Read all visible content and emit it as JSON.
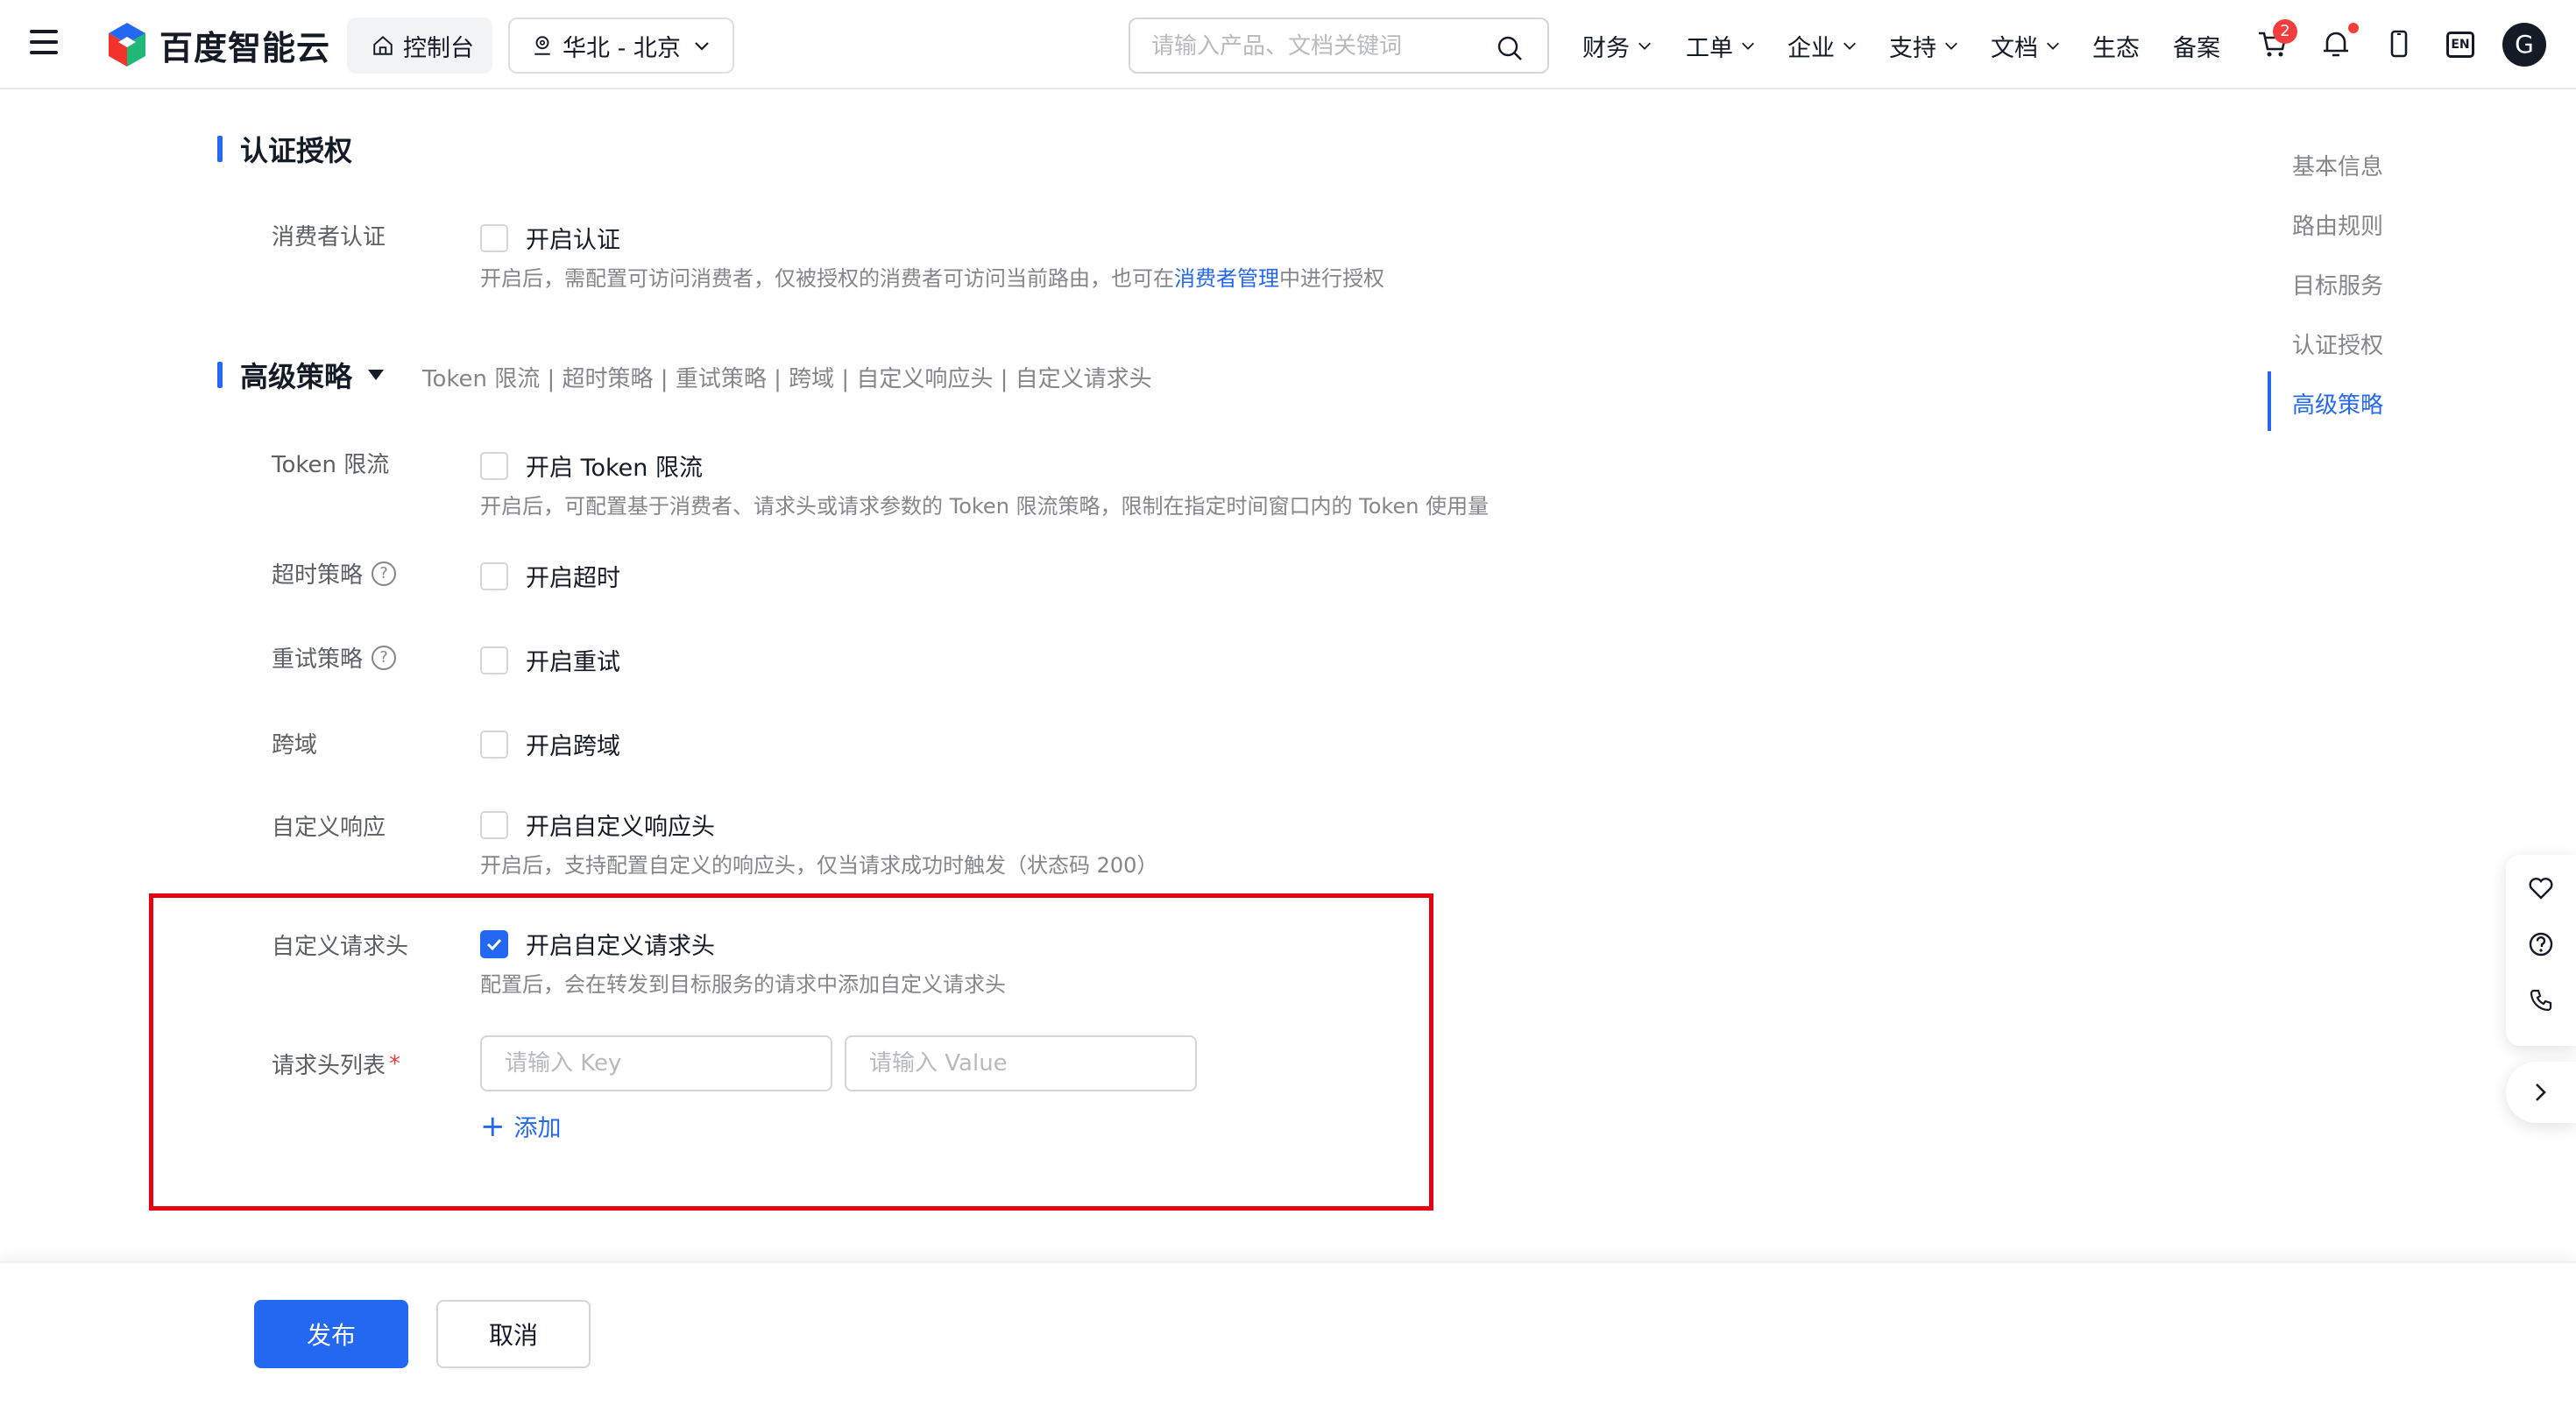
{
  "header": {
    "brand": "百度智能云",
    "console_label": "控制台",
    "region_label": "华北 - 北京",
    "search_placeholder": "请输入产品、文档关键词",
    "nav": [
      "财务",
      "工单",
      "企业",
      "支持",
      "文档",
      "生态",
      "备案"
    ],
    "cart_badge": "2",
    "lang_label": "EN",
    "avatar_letter": "G"
  },
  "auth": {
    "title": "认证授权",
    "consumer_label": "消费者认证",
    "consumer_checkbox": "开启认证",
    "consumer_help_pre": "开启后，需配置可访问消费者，仅被授权的消费者可访问当前路由，也可在",
    "consumer_help_link": "消费者管理",
    "consumer_help_post": "中进行授权"
  },
  "advanced": {
    "title": "高级策略",
    "sub_links": "Token 限流 | 超时策略 | 重试策略 | 跨域 | 自定义响应头 | 自定义请求头",
    "token_label": "Token 限流",
    "token_checkbox": "开启 Token 限流",
    "token_help": "开启后，可配置基于消费者、请求头或请求参数的 Token 限流策略，限制在指定时间窗口内的 Token 使用量",
    "timeout_label": "超时策略",
    "timeout_checkbox": "开启超时",
    "retry_label": "重试策略",
    "retry_checkbox": "开启重试",
    "cors_label": "跨域",
    "cors_checkbox": "开启跨域",
    "resp_label": "自定义响应",
    "resp_checkbox": "开启自定义响应头",
    "resp_help": "开启后，支持配置自定义的响应头，仅当请求成功时触发（状态码 200）",
    "reqh_label": "自定义请求头",
    "reqh_checkbox": "开启自定义请求头",
    "reqh_checked": true,
    "reqh_help": "配置后，会在转发到目标服务的请求中添加自定义请求头",
    "list_label": "请求头列表",
    "required_mark": "*",
    "key_placeholder": "请输入 Key",
    "value_placeholder": "请输入 Value",
    "add_label": "添加"
  },
  "anchors": [
    "基本信息",
    "路由规则",
    "目标服务",
    "认证授权",
    "高级策略"
  ],
  "active_anchor": "高级策略",
  "footer": {
    "publish_label": "发布",
    "cancel_label": "取消"
  },
  "colors": {
    "primary": "#2468f2",
    "highlight": "#e60012",
    "badge": "#f33e3e"
  }
}
